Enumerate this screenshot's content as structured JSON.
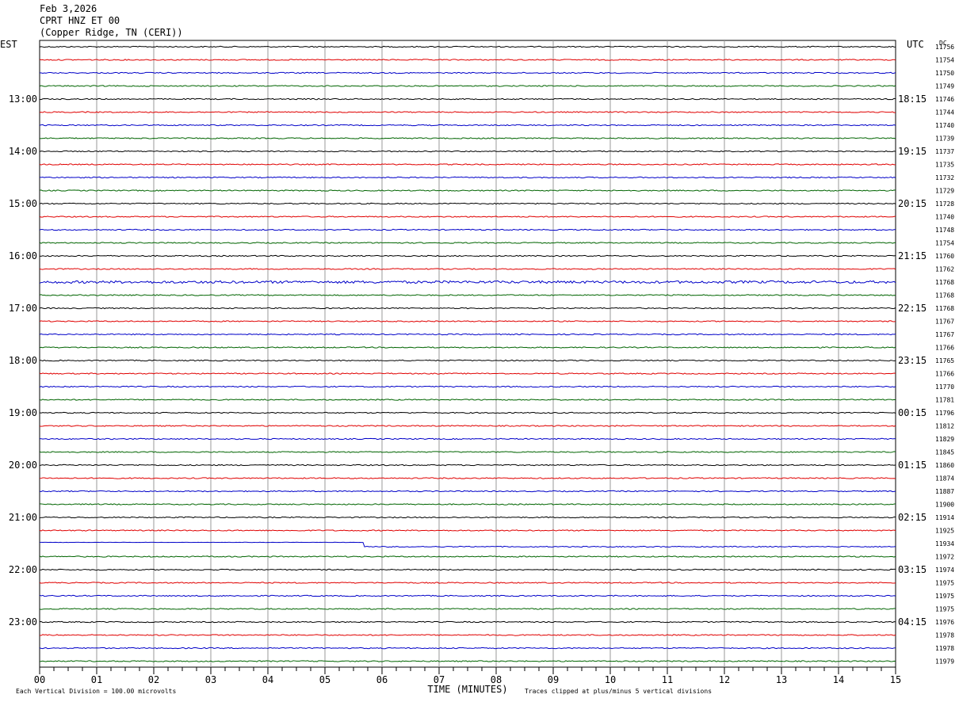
{
  "header": {
    "date": "Feb 3,2026",
    "channel": "CPRT HNZ ET 00",
    "station": "(Copper Ridge, TN (CERI))"
  },
  "chart_data": {
    "type": "line",
    "left_timezone": "EST",
    "right_timezone": "UTC",
    "dc_label": "DC",
    "xlabel": "TIME (MINUTES)",
    "xlim": [
      0,
      15
    ],
    "x_tick_labels": [
      "00",
      "01",
      "02",
      "03",
      "04",
      "05",
      "06",
      "07",
      "08",
      "09",
      "10",
      "11",
      "12",
      "13",
      "14",
      "15"
    ],
    "left_hour_labels": [
      "13:00",
      "14:00",
      "15:00",
      "16:00",
      "17:00",
      "18:00",
      "19:00",
      "20:00",
      "21:00",
      "22:00",
      "23:00"
    ],
    "right_hour_labels": [
      "18:15",
      "19:15",
      "20:15",
      "21:15",
      "22:15",
      "23:15",
      "00:15",
      "01:15",
      "02:15",
      "03:15",
      "04:15"
    ],
    "trace_colors": [
      "#000000",
      "#e00000",
      "#0000c8",
      "#006400"
    ],
    "trace_dc_values": [
      "11756",
      "11754",
      "11750",
      "11749",
      "11746",
      "11744",
      "11740",
      "11739",
      "11737",
      "11735",
      "11732",
      "11729",
      "11728",
      "11740",
      "11748",
      "11754",
      "11760",
      "11762",
      "11768",
      "11768",
      "11768",
      "11767",
      "11767",
      "11766",
      "11765",
      "11766",
      "11770",
      "11781",
      "11796",
      "11812",
      "11829",
      "11845",
      "11860",
      "11874",
      "11887",
      "11900",
      "11914",
      "11925",
      "11934",
      "11972",
      "11974",
      "11975",
      "11975",
      "11975",
      "11976",
      "11978",
      "11978",
      "11979"
    ],
    "scale_note": "Each Vertical Division =  100.00 microvolts",
    "clip_note": "Traces clipped at plus/minus 5 vertical divisions",
    "events": [
      {
        "trace_index": 38,
        "minute": 5.68,
        "note": "baseline offset step"
      }
    ]
  }
}
